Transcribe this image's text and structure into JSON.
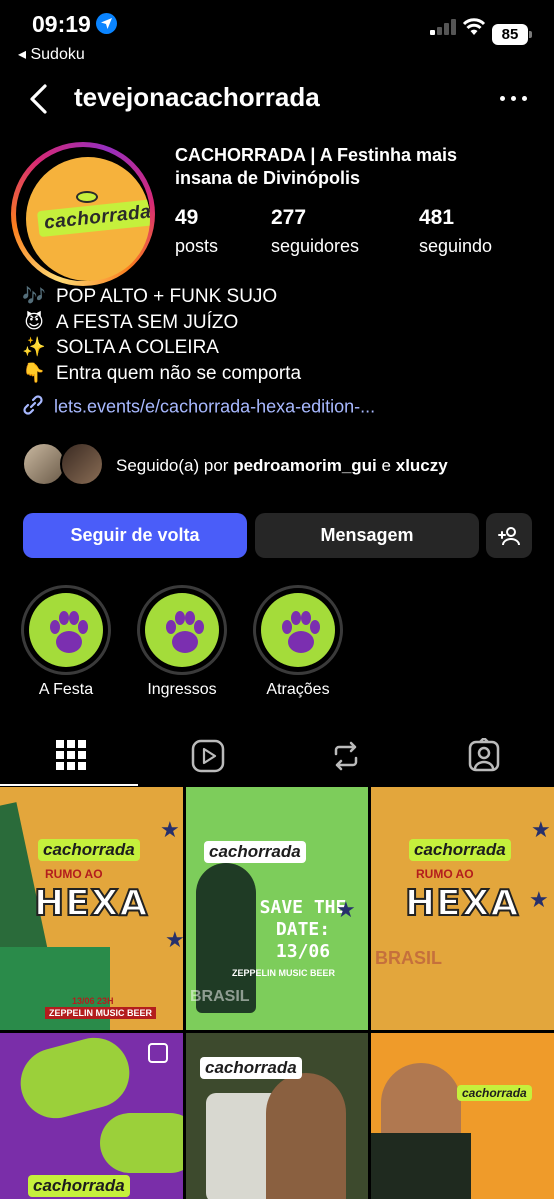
{
  "status_bar": {
    "time": "09:19",
    "back_app": "◂ Sudoku",
    "battery": "85"
  },
  "nav": {
    "username": "tevejonacachorrada"
  },
  "profile": {
    "avatar_logo": "cachorrada",
    "name": "CACHORRADA | A Festinha mais insana de Divinópolis",
    "stats": [
      {
        "value": "49",
        "label": "posts"
      },
      {
        "value": "277",
        "label": "seguidores"
      },
      {
        "value": "481",
        "label": "seguindo"
      }
    ],
    "bio": [
      {
        "emoji": "🎶",
        "text": "POP ALTO + FUNK SUJO"
      },
      {
        "emoji": "😈",
        "text": "A FESTA SEM JUÍZO"
      },
      {
        "emoji": "✨",
        "text": "SOLTA A COLEIRA"
      },
      {
        "emoji": "👇",
        "text": "Entra quem não se comporta"
      }
    ],
    "link": "lets.events/e/cachorrada-hexa-edition-...",
    "followed_by": {
      "prefix": "Seguido(a) por",
      "user1": "pedroamorim_gui",
      "conj": "e",
      "user2": "xluczy"
    }
  },
  "actions": {
    "follow_back": "Seguir de volta",
    "message": "Mensagem"
  },
  "highlights": [
    {
      "label": "A Festa"
    },
    {
      "label": "Ingressos"
    },
    {
      "label": "Atrações"
    }
  ],
  "posts": {
    "logo": "cachorrada",
    "rumo": "RUMO AO",
    "hexa": "HEXA",
    "date_small": "13/06 23H",
    "venue_small": "ZEPPELIN MUSIC BEER",
    "save_date": "SAVE THE DATE: 13/06",
    "venue": "ZEPPELIN MUSIC BEER",
    "brasil": "BRASIL"
  },
  "colors": {
    "accent_button": "#4a5df9",
    "link": "#a8b9ff",
    "highlight_bg": "#a4dc3a",
    "paw": "#7b2fb0"
  }
}
